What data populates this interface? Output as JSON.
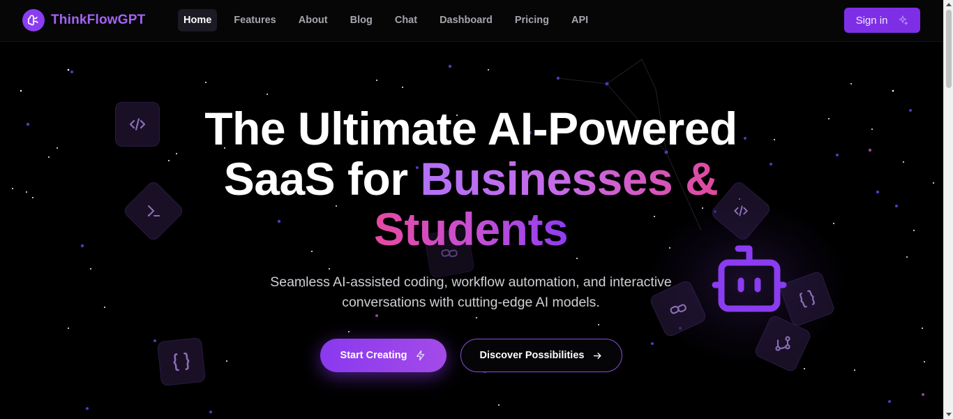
{
  "brand": {
    "name": "ThinkFlowGPT",
    "icon": "brain-icon"
  },
  "nav": {
    "items": [
      {
        "label": "Home",
        "active": true
      },
      {
        "label": "Features",
        "active": false
      },
      {
        "label": "About",
        "active": false
      },
      {
        "label": "Blog",
        "active": false
      },
      {
        "label": "Chat",
        "active": false
      },
      {
        "label": "Dashboard",
        "active": false
      },
      {
        "label": "Pricing",
        "active": false
      },
      {
        "label": "API",
        "active": false
      }
    ],
    "signin": {
      "label": "Sign in",
      "icon": "sparkles-icon"
    }
  },
  "hero": {
    "title_line1": "The Ultimate AI-Powered",
    "title_line2_plain": "SaaS for ",
    "title_line2_accent": "Businesses &",
    "title_line3_accent": "Students",
    "subtitle_line1": "Seamless AI-assisted coding, workflow automation, and interactive",
    "subtitle_line2": "conversations with cutting-edge AI models.",
    "primary_button": {
      "label": "Start Creating",
      "icon": "lightning-icon"
    },
    "secondary_button": {
      "label": "Discover Possibilities",
      "icon": "arrow-right-icon"
    }
  },
  "decor": {
    "tiles": [
      "code-icon",
      "terminal-icon",
      "braces-icon",
      "code-icon",
      "braces-icon",
      "link-icon",
      "git-branch-icon",
      "link-icon"
    ],
    "robot": "bot-icon"
  },
  "colors": {
    "accent": "#8b3df0",
    "brand_text": "#a463f7",
    "background": "#000000",
    "pink": "#e0489c"
  }
}
